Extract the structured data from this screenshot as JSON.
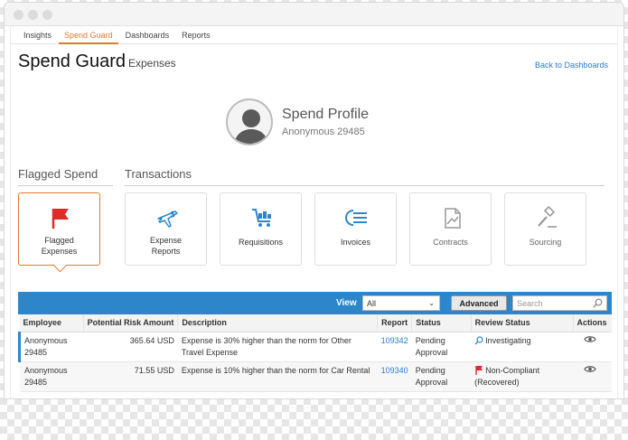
{
  "tabs": [
    {
      "label": "Insights"
    },
    {
      "label": "Spend Guard"
    },
    {
      "label": "Dashboards"
    },
    {
      "label": "Reports"
    }
  ],
  "header": {
    "title": "Spend Guard",
    "subtitle": "Expenses",
    "back_link": "Back to Dashboards"
  },
  "profile": {
    "name": "Spend Profile",
    "id": "Anonymous 29485"
  },
  "sections": {
    "flagged": "Flagged Spend",
    "transactions": "Transactions"
  },
  "cards": [
    {
      "label_line1": "Flagged",
      "label_line2": "Expenses",
      "icon": "flag-icon"
    },
    {
      "label_line1": "Expense",
      "label_line2": "Reports",
      "icon": "plane-dollar-icon"
    },
    {
      "label_line1": "Requisitions",
      "label_line2": "",
      "icon": "cart-icon"
    },
    {
      "label_line1": "Invoices",
      "label_line2": "",
      "icon": "invoice-icon"
    },
    {
      "label_line1": "Contracts",
      "label_line2": "",
      "icon": "contract-icon"
    },
    {
      "label_line1": "Sourcing",
      "label_line2": "",
      "icon": "gavel-icon"
    }
  ],
  "toolbar": {
    "view_label": "View",
    "view_value": "All",
    "advanced_label": "Advanced",
    "search_placeholder": "Search"
  },
  "table": {
    "headers": [
      "Employee",
      "Potential Risk Amount",
      "Description",
      "Report",
      "Status",
      "Review Status",
      "Actions"
    ],
    "rows": [
      {
        "employee": "Anonymous 29485",
        "amount": "365.64 USD",
        "description": "Expense is 30% higher than the norm for Other Travel Expense",
        "report": "109342",
        "status": "Pending Approval",
        "review": "Investigating",
        "review_icon": "magnifier-icon"
      },
      {
        "employee": "Anonymous 29485",
        "amount": "71.55 USD",
        "description": "Expense is 10% higher than the norm for Car Rental",
        "report": "109340",
        "status": "Pending Approval",
        "review": "Non-Compliant (Recovered)",
        "review_icon": "red-flag-icon"
      }
    ]
  },
  "colors": {
    "accent": "#e9772b",
    "primary_blue": "#2d86c9",
    "link": "#2a7ccc",
    "flag_red": "#e02b2b"
  }
}
